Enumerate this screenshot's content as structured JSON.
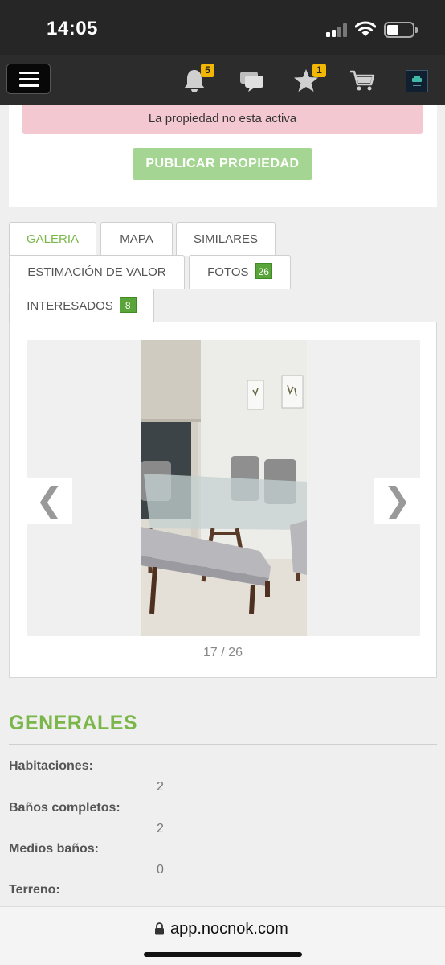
{
  "status_bar": {
    "time": "14:05"
  },
  "nav": {
    "notifications_count": "5",
    "favorites_count": "1",
    "icons": [
      "menu-icon",
      "bell-icon",
      "chat-icon",
      "star-icon",
      "cart-icon",
      "avatar"
    ]
  },
  "alert": {
    "text": "La propiedad no esta activa"
  },
  "publish_button": {
    "label": "PUBLICAR PROPIEDAD"
  },
  "tabs": [
    {
      "label": "GALERIA",
      "active": true
    },
    {
      "label": "MAPA"
    },
    {
      "label": "SIMILARES"
    },
    {
      "label": "ESTIMACIÓN DE VALOR"
    },
    {
      "label": "FOTOS",
      "badge": "26"
    },
    {
      "label": "INTERESADOS",
      "badge": "8"
    }
  ],
  "gallery": {
    "prev_arrow": "❮",
    "next_arrow": "❯",
    "counter": "17 / 26"
  },
  "generales": {
    "title": "GENERALES",
    "items": [
      {
        "label": "Habitaciones:",
        "value": "2"
      },
      {
        "label": "Baños completos:",
        "value": "2"
      },
      {
        "label": "Medios baños:",
        "value": "0"
      },
      {
        "label": "Terreno:",
        "value": ""
      }
    ]
  },
  "browser": {
    "url": "app.nocnok.com"
  },
  "colors": {
    "accent_green": "#7ab648",
    "badge_yellow": "#f2b705",
    "alert_pink": "#f3c8d0",
    "publish_green": "#a5d592"
  }
}
